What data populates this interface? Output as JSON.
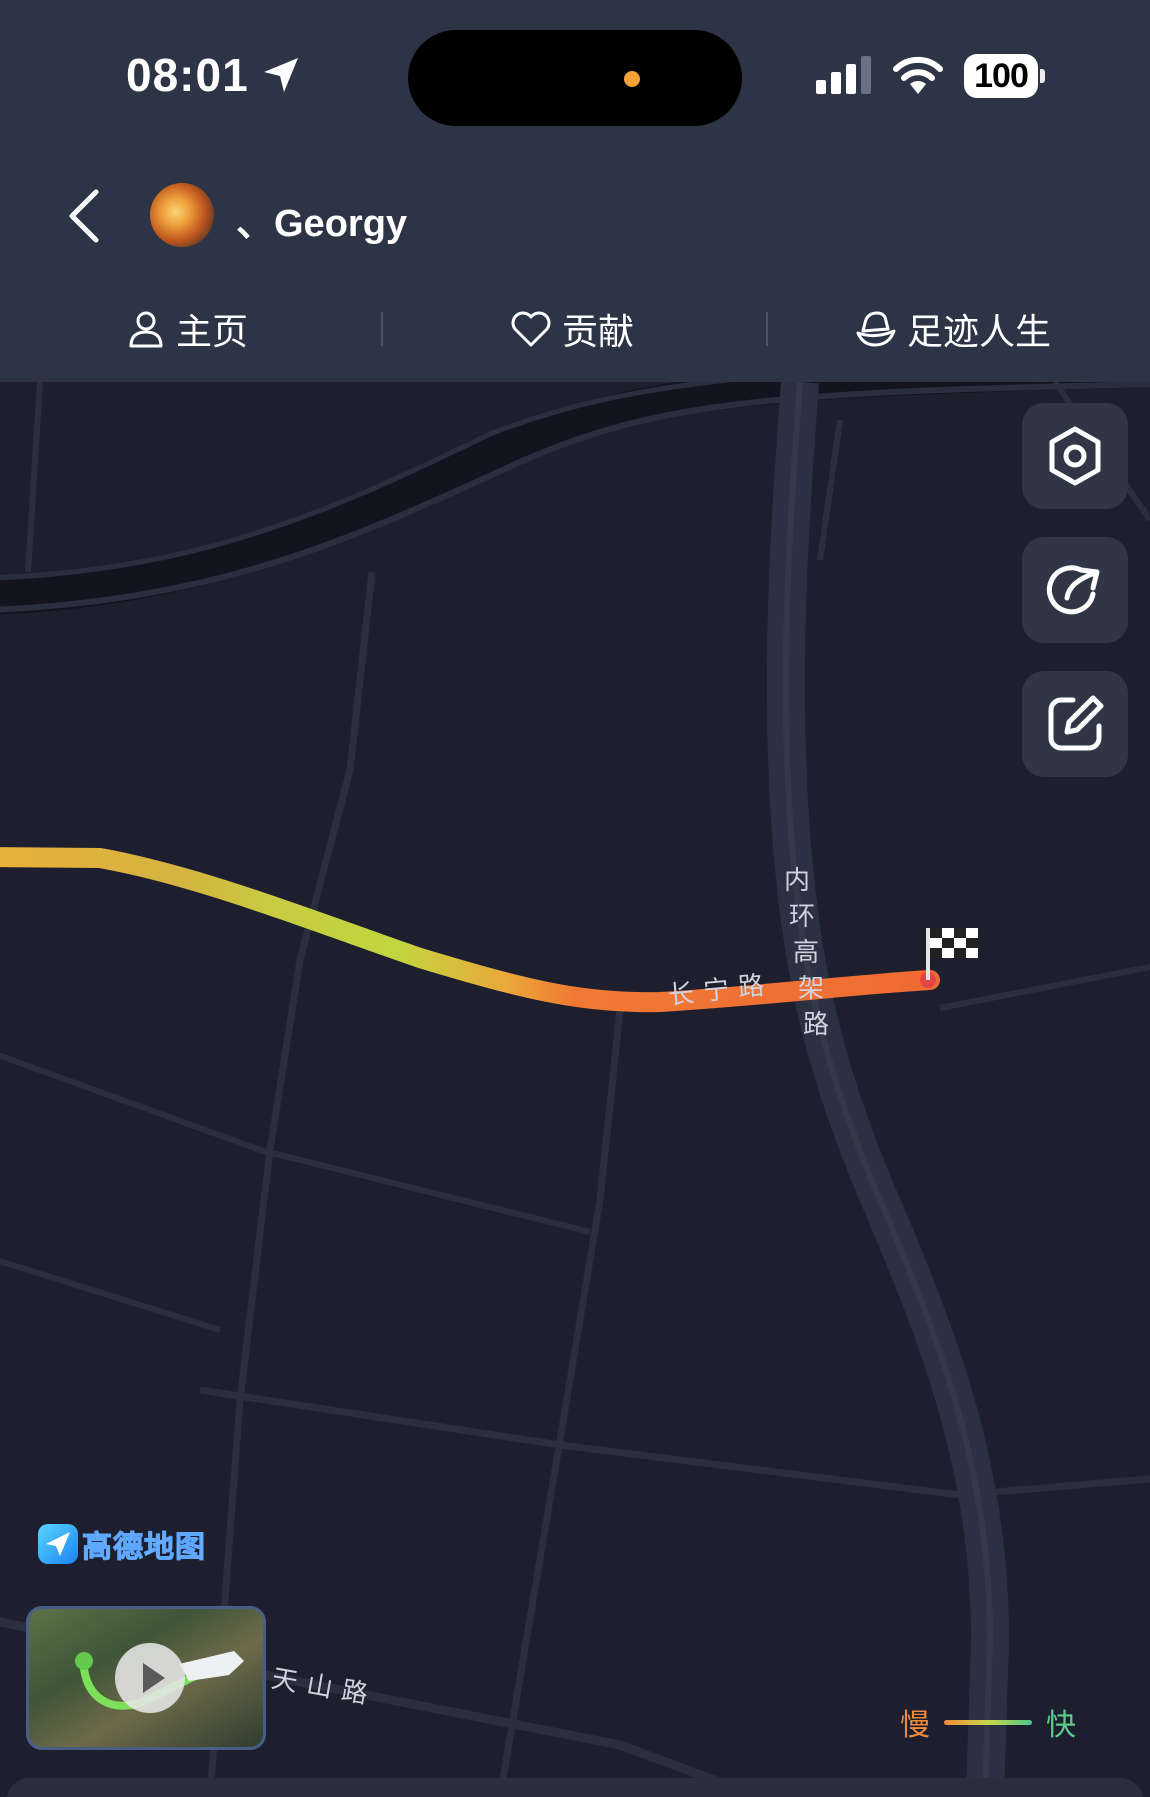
{
  "status_bar": {
    "time": "08:01",
    "battery": "100"
  },
  "header": {
    "username": "、Georgy"
  },
  "tabs": [
    {
      "label": "主页",
      "icon": "person-icon"
    },
    {
      "label": "贡献",
      "icon": "heart-icon"
    },
    {
      "label": "足迹人生",
      "icon": "footprint-icon"
    }
  ],
  "map": {
    "provider_logo": "高德地图",
    "road_labels": {
      "changning": [
        "长",
        "宁",
        "路"
      ],
      "inner_ring": [
        "内",
        "环",
        "高",
        "架",
        "路"
      ],
      "tianshan": [
        "天",
        "山",
        "路"
      ]
    },
    "controls": [
      {
        "name": "settings-hex-button",
        "icon": "hexagon-settings-icon"
      },
      {
        "name": "share-button",
        "icon": "share-icon"
      },
      {
        "name": "edit-button",
        "icon": "edit-icon"
      }
    ],
    "legend": {
      "slow": "慢",
      "fast": "快"
    },
    "colors": {
      "route_orange": "#f07a33",
      "route_yellow": "#d9c53e",
      "route_green": "#bfd93e",
      "map_bg": "#1d1f2f",
      "road": "#2a2e3e",
      "header_bg": "#2d3446"
    }
  }
}
